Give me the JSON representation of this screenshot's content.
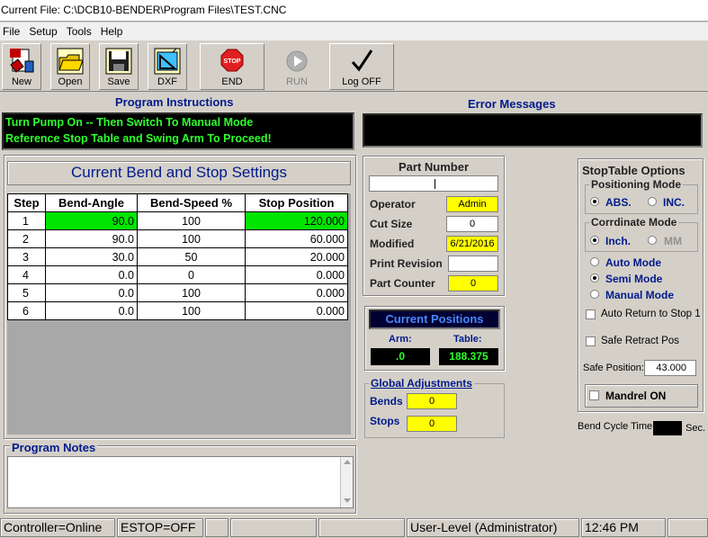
{
  "window": {
    "title": "Current File: C:\\DCB10-BENDER\\Program Files\\TEST.CNC"
  },
  "menu": [
    "File",
    "Setup",
    "Tools",
    "Help"
  ],
  "toolbar": {
    "new": "New",
    "open": "Open",
    "save": "Save",
    "dxf": "DXF",
    "end": "END",
    "run": "RUN",
    "logoff": "Log OFF"
  },
  "instructions": {
    "header": "Program Instructions",
    "line1": "Turn Pump On -- Then Switch To Manual Mode",
    "line2": "Reference Stop Table and Swing Arm To Proceed!"
  },
  "errors": {
    "header": "Error Messages"
  },
  "bend_settings": {
    "title": "Current Bend and Stop Settings",
    "columns": [
      "Step",
      "Bend-Angle",
      "Bend-Speed %",
      "Stop Position"
    ],
    "rows": [
      [
        "1",
        "90.0",
        "100",
        "120.000"
      ],
      [
        "2",
        "90.0",
        "100",
        "60.000"
      ],
      [
        "3",
        "30.0",
        "50",
        "20.000"
      ],
      [
        "4",
        "0.0",
        "0",
        "0.000"
      ],
      [
        "5",
        "0.0",
        "100",
        "0.000"
      ],
      [
        "6",
        "0.0",
        "100",
        "0.000"
      ]
    ],
    "highlight_color": "#00e600"
  },
  "part": {
    "header": "Part Number",
    "part_number": "",
    "operator_label": "Operator",
    "operator": "Admin",
    "cut_size_label": "Cut Size",
    "cut_size": "0",
    "modified_label": "Modified",
    "modified": "6/21/2016",
    "print_rev_label": "Print Revision",
    "print_rev": "",
    "counter_label": "Part Counter",
    "counter": "0"
  },
  "positions": {
    "header": "Current Positions",
    "arm_label": "Arm:",
    "arm": ".0",
    "table_label": "Table:",
    "table": "188.375"
  },
  "global_adj": {
    "legend": "Global Adjustments",
    "bends_label": "Bends",
    "bends": "0",
    "stops_label": "Stops",
    "stops": "0"
  },
  "stoptable": {
    "header": "StopTable Options",
    "pos_mode_legend": "Positioning Mode",
    "abs": "ABS.",
    "inc": "INC.",
    "coord_legend": "Corrdinate Mode",
    "inch": "Inch.",
    "mm": "MM",
    "auto_mode": "Auto Mode",
    "semi_mode": "Semi Mode",
    "manual_mode": "Manual Mode",
    "auto_return": "Auto Return to Stop 1",
    "safe_retract": "Safe Retract Pos",
    "safe_pos_label": "Safe Position:",
    "safe_pos": "43.000",
    "mandrel": "Mandrel ON",
    "cycle_label": "Bend Cycle Time",
    "cycle_unit": "Sec."
  },
  "notes": {
    "header": "Program Notes"
  },
  "statusbar": {
    "controller": "Controller=Online",
    "estop": "ESTOP=OFF",
    "user": "User-Level (Administrator)",
    "time": "12:46 PM"
  }
}
